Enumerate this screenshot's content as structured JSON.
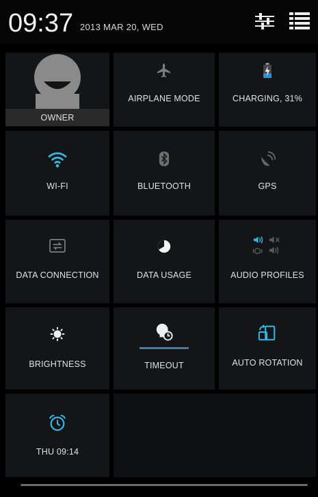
{
  "status": {
    "time": "09:37",
    "date": "2013 MAR 20, WED"
  },
  "tiles": {
    "owner": {
      "label": "OWNER"
    },
    "airplane": {
      "label": "AIRPLANE MODE"
    },
    "battery": {
      "label": "CHARGING, 31%",
      "level": 31
    },
    "wifi": {
      "label": "WI-FI"
    },
    "bluetooth": {
      "label": "BLUETOOTH"
    },
    "gps": {
      "label": "GPS"
    },
    "data_connection": {
      "label": "DATA CONNECTION"
    },
    "data_usage": {
      "label": "DATA USAGE"
    },
    "audio_profiles": {
      "label": "AUDIO PROFILES"
    },
    "brightness": {
      "label": "BRIGHTNESS"
    },
    "timeout": {
      "label": "TIMEOUT"
    },
    "auto_rotation": {
      "label": "AUTO ROTATION"
    },
    "alarm": {
      "label": "THU 09:14"
    }
  },
  "colors": {
    "accent": "#33b5e5",
    "tile_bg": "#141516",
    "battery_fill": "#2a8fd6"
  },
  "icons": {
    "quick_settings": "sliders-icon",
    "notifications": "list-icon"
  }
}
